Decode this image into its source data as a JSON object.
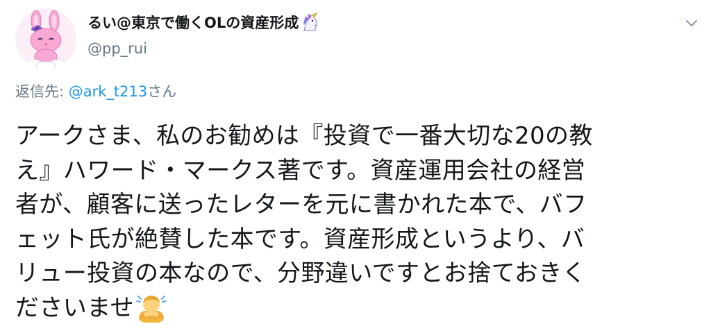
{
  "tweet": {
    "display_name": "るい@東京で働くOLの資産形成",
    "name_icon": "unicorn-icon",
    "handle": "@pp_rui",
    "avatar_icon": "pink-bunny-avatar",
    "menu_icon": "chevron-down-icon",
    "reply_prefix": "返信先: ",
    "reply_target": "@ark_t213",
    "reply_suffix": "さん",
    "text_lines": [
      "アークさま、私のお勧めは『投資で一番大切な20の教",
      "え』ハワード・マークス著です。資産運用会社の経営",
      "者が、顧客に送ったレターを元に書かれた本で、バフ",
      "ェット氏が絶賛した本です。資産形成というより、バ",
      "リュー投資の本なので、分野違いですとお捨ておきく",
      "ださいませ"
    ],
    "text_end_icon": "person-bowing-icon"
  },
  "colors": {
    "text": "#14171a",
    "secondary": "#657786",
    "link": "#1b95e0",
    "background": "#ffffff"
  }
}
